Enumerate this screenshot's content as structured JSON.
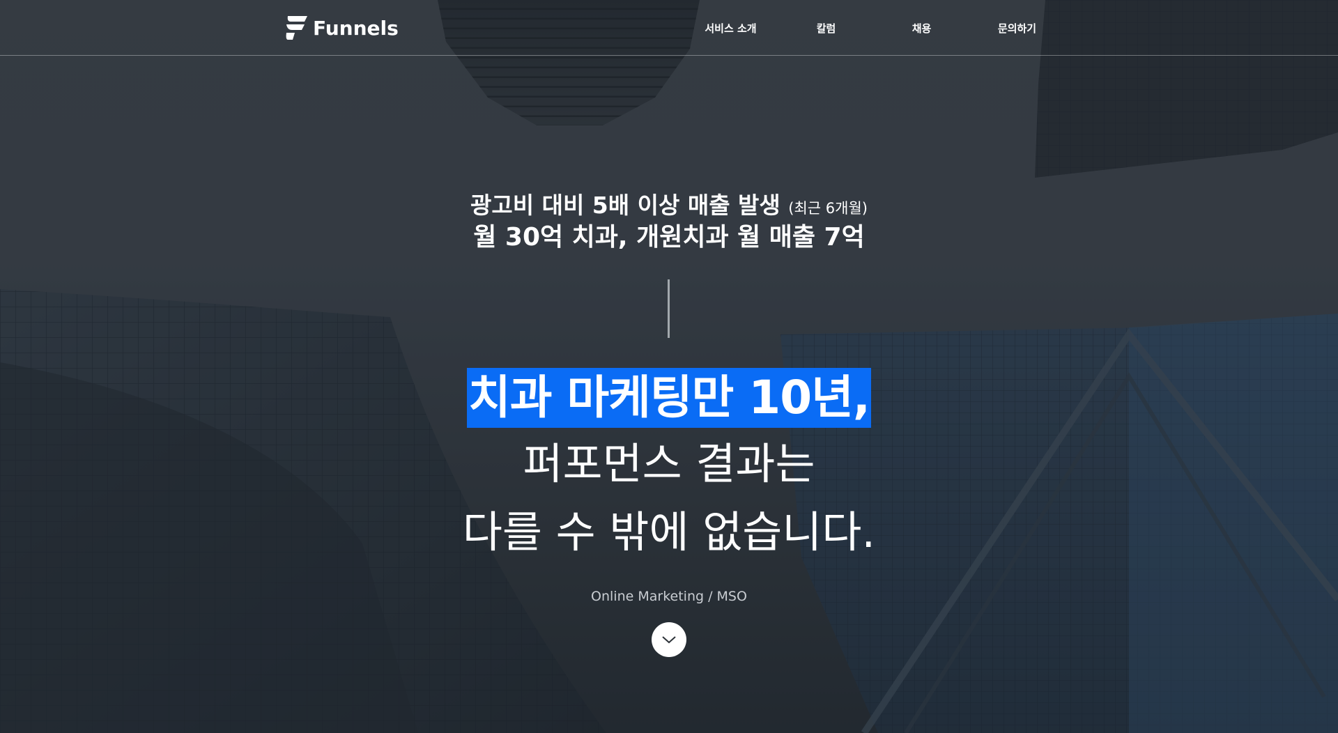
{
  "header": {
    "logo_text": "Funnels",
    "nav": [
      {
        "label": "서비스 소개"
      },
      {
        "label": "칼럼"
      },
      {
        "label": "채용"
      },
      {
        "label": "문의하기"
      }
    ]
  },
  "hero": {
    "stat_line_1": "광고비 대비 5배 이상 매출 발생",
    "stat_line_1_note": "(최근 6개월)",
    "stat_line_2": "월 30억 치과, 개원치과 월 매출 7억",
    "headline_highlight": "치과 마케팅만 10년,",
    "headline_line_2": "퍼포먼스 결과는",
    "headline_line_3": "다를 수 밖에 없습니다.",
    "tagline": "Online Marketing / MSO",
    "scroll_icon": "chevron-down-icon"
  },
  "colors": {
    "highlight": "#0a6cf5",
    "overlay": "#2c3238",
    "text": "#ffffff"
  }
}
